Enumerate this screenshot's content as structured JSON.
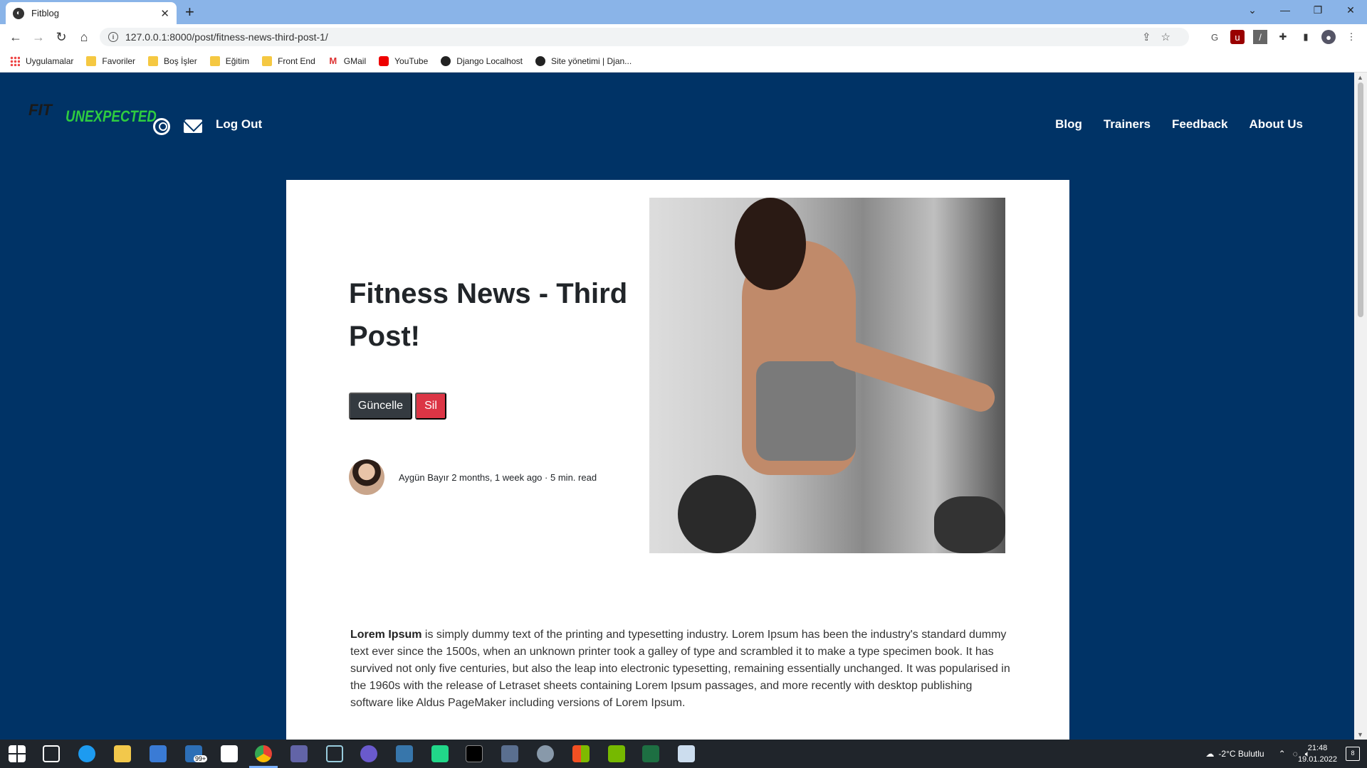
{
  "browser": {
    "tab_title": "Fitblog",
    "tab_favicon": "globe-icon",
    "url": "127.0.0.1:8000/post/fitness-news-third-post-1/",
    "bookmarks": [
      "Uygulamalar",
      "Favoriler",
      "Boş İşler",
      "Eğitim",
      "Front End",
      "GMail",
      "YouTube",
      "Django Localhost",
      "Site yönetimi | Djan..."
    ]
  },
  "site": {
    "logo_text_top": "FIT",
    "logo_text_main": "UNEXPECTED",
    "logout_label": "Log Out",
    "nav": [
      "Blog",
      "Trainers",
      "Feedback",
      "About Us"
    ],
    "background_color": "#003366"
  },
  "post": {
    "title": "Fitness News - Third Post!",
    "update_button": "Güncelle",
    "delete_button": "Sil",
    "author": "Aygün Bayır",
    "time_ago": "2 months, 1 week ago",
    "separator": "·",
    "read_time": "5 min. read",
    "body_lead": "Lorem Ipsum",
    "body_text": " is simply dummy text of the printing and typesetting industry. Lorem Ipsum has been the industry's standard dummy text ever since the 1500s, when an unknown printer took a galley of type and scrambled it to make a type specimen book. It has survived not only five centuries, but also the leap into electronic typesetting, remaining essentially unchanged. It was popularised in the 1960s with the release of Letraset sheets containing Lorem Ipsum passages, and more recently with desktop publishing software like Aldus PageMaker including versions of Lorem Ipsum."
  },
  "taskbar": {
    "weather": "-2°C  Bulutlu",
    "time": "21:48",
    "date": "19.01.2022",
    "mail_badge": "99+",
    "notification_count": "8"
  }
}
